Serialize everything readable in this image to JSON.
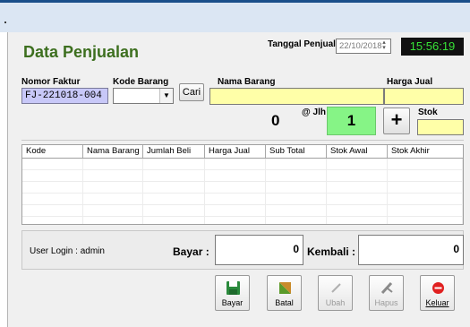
{
  "window": {
    "title": "Data Penjualan",
    "date_label": "Tanggal Penjualan",
    "date_value": "22/10/2018",
    "clock": "15:56:19"
  },
  "form": {
    "nomor_faktur_label": "Nomor Faktur",
    "nomor_faktur_value": "FJ-221018-004",
    "kode_barang_label": "Kode Barang",
    "kode_barang_value": "",
    "cari_label": "Cari",
    "nama_barang_label": "Nama Barang",
    "nama_barang_value": "",
    "harga_jual_label": "Harga Jual",
    "harga_jual_value": "",
    "qty_current": "0",
    "jlh_label": "@ Jlh",
    "jlh_value": "1",
    "plus_label": "+",
    "stok_label": "Stok",
    "stok_value": ""
  },
  "table": {
    "columns": [
      "Kode",
      "Nama Barang",
      "Jumlah Beli",
      "Harga Jual",
      "Sub Total",
      "Stok Awal",
      "Stok Akhir"
    ]
  },
  "footer": {
    "user_login_label": "User Login :",
    "user_login_value": "admin",
    "bayar_label": "Bayar :",
    "bayar_value": "0",
    "kembali_label": "Kembali :",
    "kembali_value": "0"
  },
  "actions": [
    {
      "label": "Bayar",
      "icon": "save-icon",
      "enabled": true
    },
    {
      "label": "Batal",
      "icon": "cancel-icon",
      "enabled": true
    },
    {
      "label": "Ubah",
      "icon": "edit-icon",
      "enabled": false
    },
    {
      "label": "Hapus",
      "icon": "delete-icon",
      "enabled": false
    },
    {
      "label": "Keluar",
      "icon": "exit-icon",
      "enabled": true
    }
  ],
  "colors": {
    "title_green": "#3d6f1f",
    "field_yellow": "#ffffa8",
    "jlh_green": "#86f486",
    "faktur_field": "#c8c8f8",
    "clock_text": "#37e237"
  }
}
